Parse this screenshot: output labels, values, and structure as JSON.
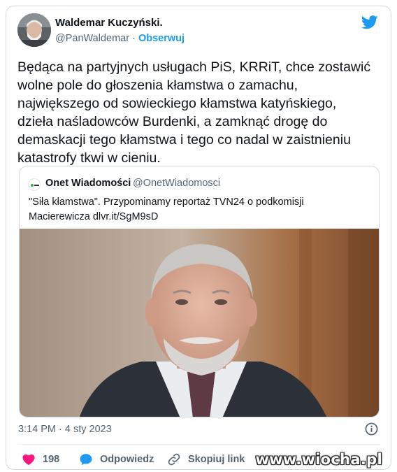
{
  "author": {
    "name": "Waldemar Kuczyński.",
    "handle": "@PanWaldemar",
    "separator": " · ",
    "follow_label": "Obserwuj"
  },
  "tweet": {
    "text": "Będąca na partyjnych usługach PiS, KRRiT, chce zostawić\nwolne pole do głoszenia kłamstwa o zamachu,\nnajwiększego od sowieckiego kłamstwa katyńskiego,\ndzieła naśladowców Burdenki, a zamknąć drogę do\ndemaskacji tego kłamstwa i tego co nadal w zaistnieniu\nkatastrofy tkwi w cieniu."
  },
  "quoted": {
    "name": "Onet Wiadomości",
    "handle": "@OnetWiadomosci",
    "text": "\"Siła kłamstwa\". Przypominamy reportaż TVN24 o podkomisji\nMacierewicza dlvr.it/SgM9sD"
  },
  "footer": {
    "timestamp": "3:14 PM · 4 sty 2023"
  },
  "actions": {
    "like_count": "198",
    "reply_label": "Odpowiedz",
    "copy_label": "Skopiuj link"
  },
  "watermark": "www.wiocha.pl",
  "colors": {
    "accent": "#1d9bf0",
    "like": "#f91880",
    "text": "#0f1419",
    "muted": "#536471",
    "border": "#cfd9de"
  },
  "icons": [
    "twitter-bird-icon",
    "heart-icon",
    "reply-bubble-icon",
    "link-icon",
    "info-icon"
  ]
}
